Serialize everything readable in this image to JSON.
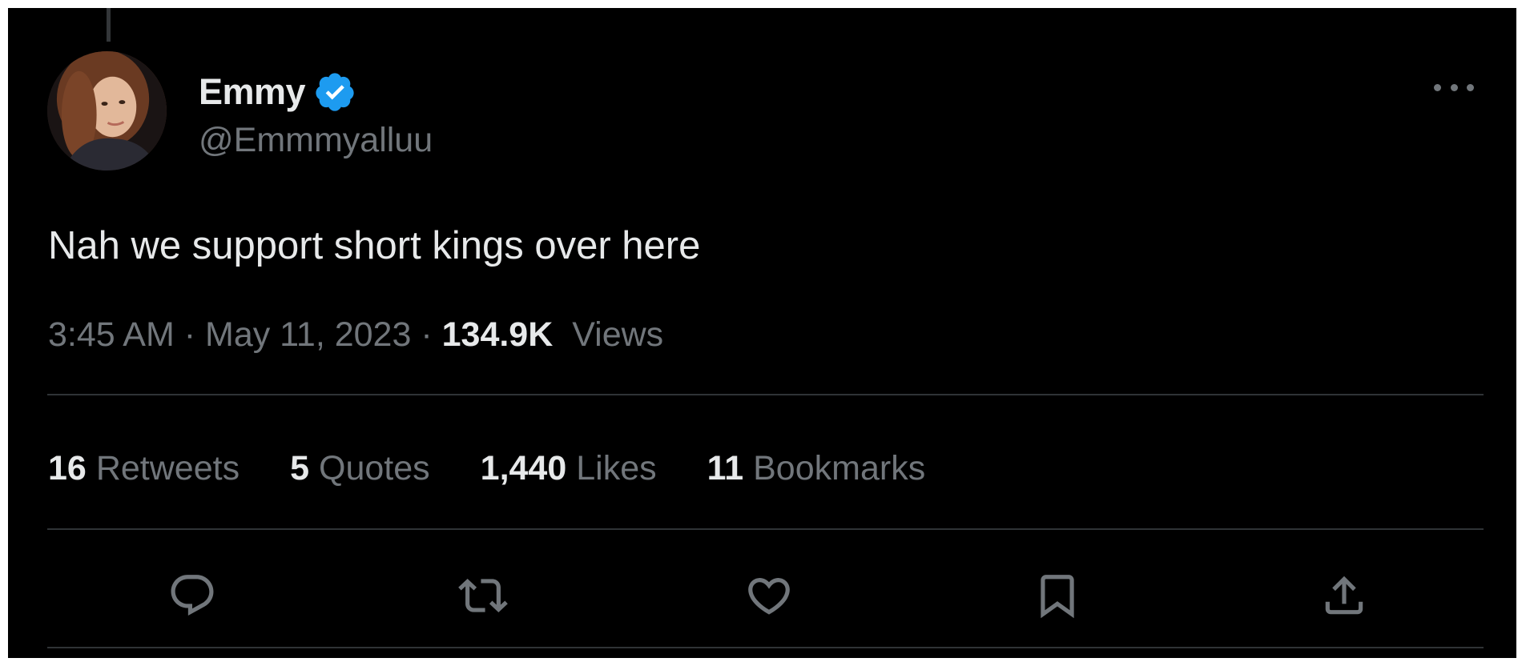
{
  "author": {
    "display_name": "Emmy",
    "handle": "@Emmmyalluu",
    "verified_icon": "verified-badge-icon",
    "verified_color": "#1d9bf0"
  },
  "tweet": {
    "text": "Nah we support short kings over here",
    "time": "3:45 AM",
    "separator": "·",
    "date": "May 11, 2023",
    "views_count": "134.9K",
    "views_label": "Views"
  },
  "stats": [
    {
      "count": "16",
      "label": "Retweets"
    },
    {
      "count": "5",
      "label": "Quotes"
    },
    {
      "count": "1,440",
      "label": "Likes"
    },
    {
      "count": "11",
      "label": "Bookmarks"
    }
  ],
  "actions": [
    {
      "icon": "reply-icon"
    },
    {
      "icon": "retweet-icon"
    },
    {
      "icon": "like-icon"
    },
    {
      "icon": "bookmark-icon"
    },
    {
      "icon": "share-icon"
    }
  ],
  "more_icon": "more-options-icon",
  "colors": {
    "background": "#000000",
    "primary_text": "#e7e9ea",
    "secondary_text": "#71767b",
    "divider": "#2f3336",
    "accent": "#1d9bf0"
  }
}
